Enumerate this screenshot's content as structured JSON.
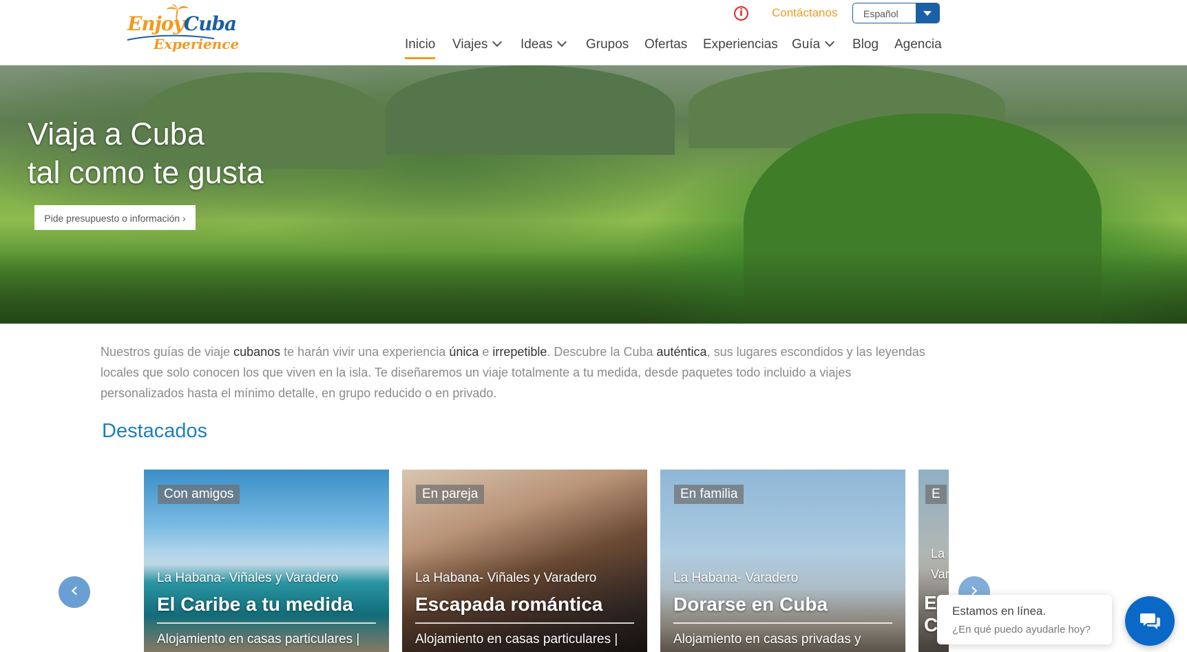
{
  "brand": {
    "logo_enjoy": "Enjoy",
    "logo_cuba": "Cuba",
    "logo_experience": "Experience"
  },
  "topbar": {
    "contact_label": "Contáctanos",
    "language_value": "Español"
  },
  "nav": {
    "items": [
      {
        "label": "Inicio"
      },
      {
        "label": "Viajes"
      },
      {
        "label": "Ideas"
      },
      {
        "label": "Grupos"
      },
      {
        "label": "Ofertas"
      },
      {
        "label": "Experiencias"
      },
      {
        "label": "Guía"
      },
      {
        "label": "Blog"
      },
      {
        "label": "Agencia"
      }
    ]
  },
  "hero": {
    "title_line1": "Viaja a Cuba",
    "title_line2": "tal como te gusta",
    "cta_label": "Pide presupuesto o información ›"
  },
  "intro": {
    "t1": "Nuestros guías de viaje ",
    "b1": "cubanos",
    "t2": " te harán vivir una experiencia ",
    "b2": "única",
    "t3": " e ",
    "b3": "irrepetible",
    "t4": ". Descubre la Cuba ",
    "b4": "auténtica",
    "t5": ", sus lugares escondidos y las leyendas locales que solo conocen los que viven en la isla. Te diseñaremos un viaje totalmente a tu medida, desde paquetes todo incluido a viajes personalizados hasta el mínimo detalle, en grupo reducido o en privado."
  },
  "featured": {
    "title": "Destacados",
    "cards": [
      {
        "badge": "Con amigos",
        "route": "La Habana- Viñales y Varadero",
        "title": "El Caribe a tu medida",
        "desc": "Alojamiento en casas particulares |"
      },
      {
        "badge": "En pareja",
        "route": "La Habana- Viñales y Varadero",
        "title": "Escapada romántica",
        "desc": "Alojamiento en casas particulares |"
      },
      {
        "badge": "En familia",
        "route": "La Habana- Varadero",
        "title": "Dorarse en Cuba",
        "desc": "Alojamiento en casas privadas y"
      },
      {
        "badge": "E",
        "route": "La",
        "route2": "Var",
        "title": "E",
        "title2": "C"
      }
    ],
    "prev_symbol": "‹",
    "next_symbol": "›"
  },
  "chat": {
    "line1": "Estamos en línea.",
    "line2": "¿En qué puedo ayudarle hoy?"
  },
  "colors": {
    "accent": "#f39a1e",
    "brand_blue": "#1b5fa5",
    "title_blue": "#1b7fc1",
    "chat_blue": "#0a69c7"
  },
  "icons": {
    "info": "info-circle-icon",
    "dropdown": "caret-down-icon",
    "chat": "chat-bubbles-icon"
  }
}
